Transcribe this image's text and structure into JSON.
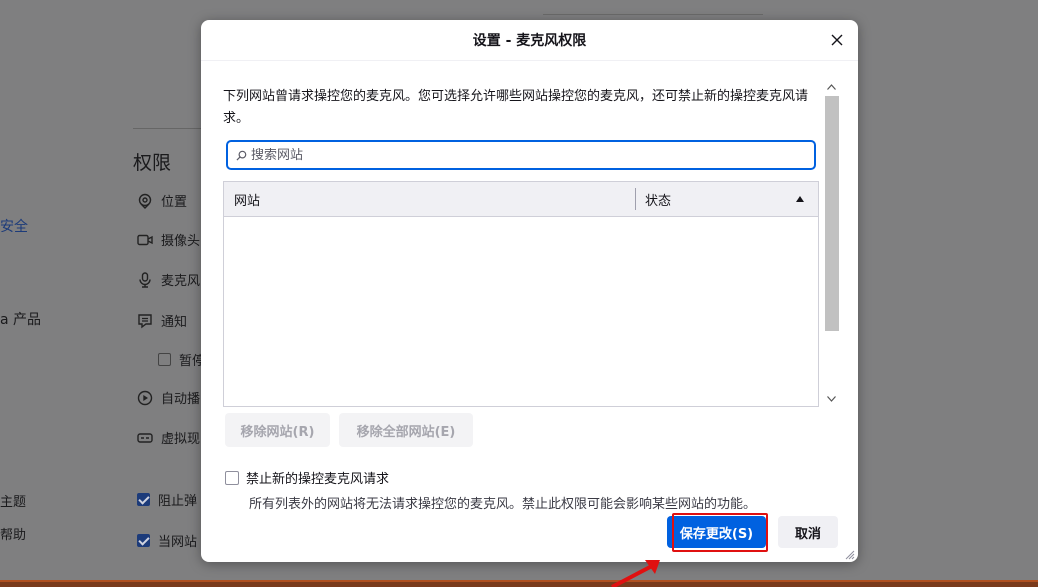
{
  "background": {
    "left_items": [
      {
        "label": "安全",
        "style": "link"
      },
      {
        "label": "a 产品",
        "style": "plain"
      },
      {
        "label": "主题",
        "style": "plain"
      },
      {
        "label": "帮助",
        "style": "plain"
      }
    ],
    "heading": "权限",
    "permission_items": {
      "location": "位置",
      "camera": "摄像头",
      "microphone": "麦克风",
      "notifications": "通知",
      "pause_notifications": "暂停",
      "autoplay": "自动播",
      "virtual_reality": "虚拟现",
      "block_popups": "阻止弹",
      "warn_addons": "当网站"
    }
  },
  "dialog": {
    "title": "设置 - 麦克风权限",
    "description": "下列网站曾请求操控您的麦克风。您可选择允许哪些网站操控您的麦克风，还可禁止新的操控麦克风请求。",
    "search_placeholder": "搜索网站",
    "table": {
      "col_site": "网站",
      "col_status": "状态",
      "rows": []
    },
    "remove_button": "移除网站(R)",
    "remove_all_button": "移除全部网站(E)",
    "block_new_label": "禁止新的操控麦克风请求",
    "block_new_note": "所有列表外的网站将无法请求操控您的麦克风。禁止此权限可能会影响某些网站的功能。",
    "save_button": "保存更改(S)",
    "cancel_button": "取消"
  },
  "colors": {
    "accent": "#0061e0",
    "highlight": "#e01010",
    "overlay": "#7f7f80"
  }
}
